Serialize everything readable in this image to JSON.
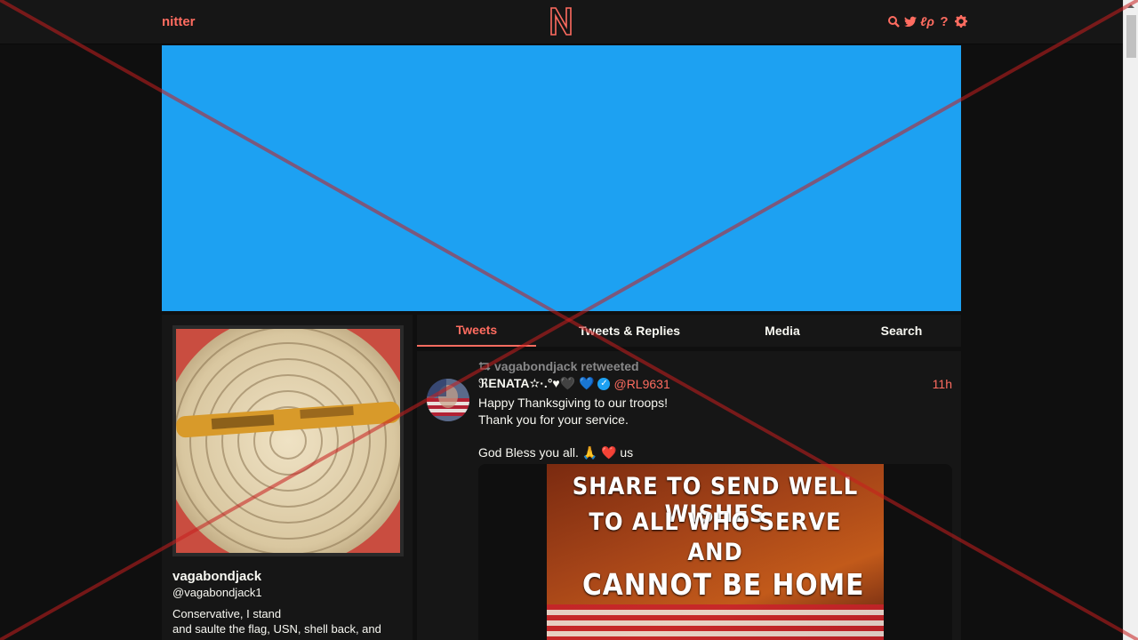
{
  "navbar": {
    "logo_text": "nitter",
    "icons": [
      "search-icon",
      "twitter-bird-icon",
      "rss-icon",
      "help-icon",
      "settings-icon"
    ]
  },
  "profile": {
    "fullname": "vagabondjack",
    "username": "@vagabondjack1",
    "bio": "Conservative, I stand\n and saulte the flag, USN, shell back, and"
  },
  "tabs": [
    {
      "label": "Tweets",
      "active": true
    },
    {
      "label": "Tweets & Replies",
      "active": false
    },
    {
      "label": "Media",
      "active": false
    },
    {
      "label": "Search",
      "active": false
    }
  ],
  "tweet": {
    "retweet_label": "vagabondjack retweeted",
    "fullname": "ℜENATA✫·.°♥🖤 💙",
    "handle": "@RL9631",
    "date": "11h",
    "content": "Happy Thanksgiving to our troops!\nThank you for your service.\n\nGod Bless you all. 🙏 ❤️ us",
    "media_text": [
      "SHARE TO SEND WELL WISHES",
      "TO ALL WHO SERVE",
      "AND",
      "CANNOT BE HOME"
    ]
  },
  "colors": {
    "accent": "#ff6c60",
    "banner": "#1da1f2",
    "background": "#0f0f0f",
    "panel": "#161616"
  }
}
